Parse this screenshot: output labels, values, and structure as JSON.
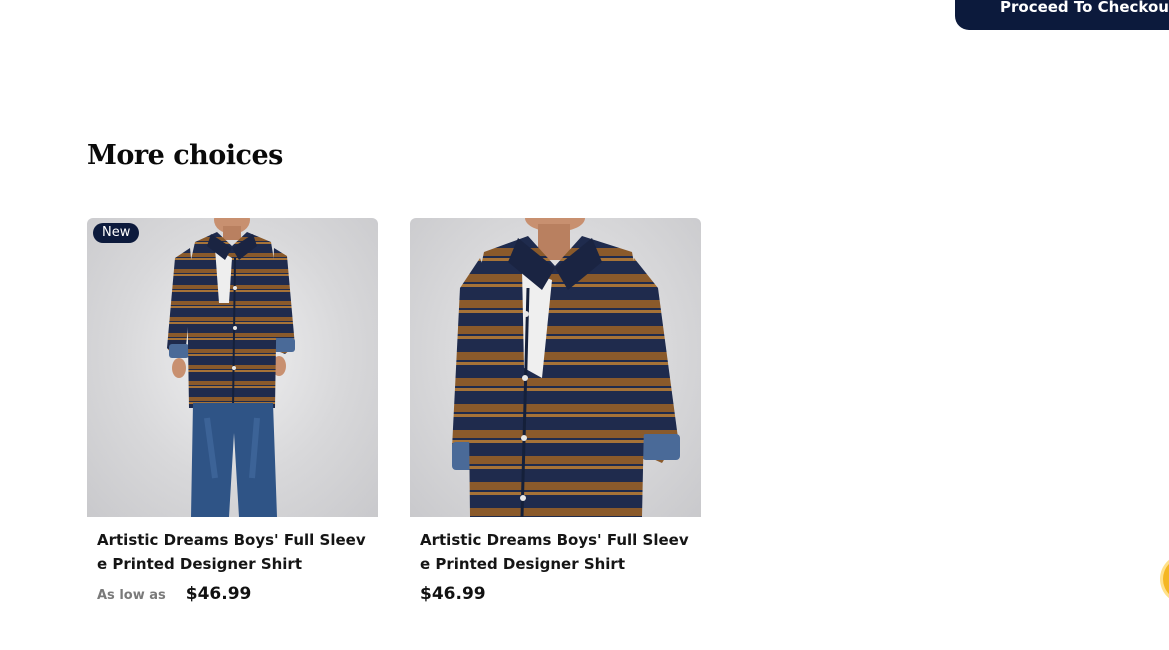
{
  "header": {
    "checkout_label": "Proceed To Checkout"
  },
  "section": {
    "title": "More choices"
  },
  "products": [
    {
      "badge": "New",
      "title": "Artistic Dreams Boys' Full Sleeve Printed Designer Shirt",
      "price_label": "As low as",
      "price": "$46.99"
    },
    {
      "title": "Artistic Dreams Boys' Full Sleeve Printed Designer Shirt",
      "price": "$46.99"
    }
  ],
  "icons": {
    "chat": "chat-icon"
  },
  "colors": {
    "brand_navy": "#0c1a3c",
    "shirt_navy": "#1f2b4d",
    "shirt_stripe": "#8a5a2b",
    "jeans": "#2f5486",
    "fab_yellow": "#f4b623"
  }
}
